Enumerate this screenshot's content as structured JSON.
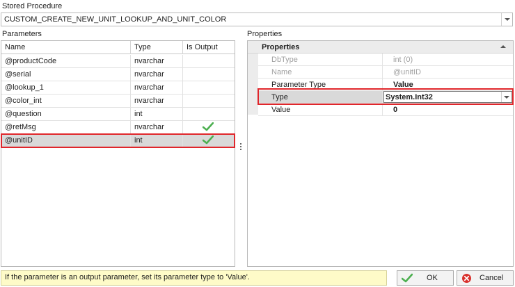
{
  "stored_procedure": {
    "label": "Stored Procedure",
    "value": "CUSTOM_CREATE_NEW_UNIT_LOOKUP_AND_UNIT_COLOR"
  },
  "parameters": {
    "label": "Parameters",
    "columns": [
      "Name",
      "Type",
      "Is Output"
    ],
    "rows": [
      {
        "name": "@productCode",
        "type": "nvarchar",
        "is_output": false
      },
      {
        "name": "@serial",
        "type": "nvarchar",
        "is_output": false
      },
      {
        "name": "@lookup_1",
        "type": "nvarchar",
        "is_output": false
      },
      {
        "name": "@color_int",
        "type": "nvarchar",
        "is_output": false
      },
      {
        "name": "@question",
        "type": "int",
        "is_output": false
      },
      {
        "name": "@retMsg",
        "type": "nvarchar",
        "is_output": true
      },
      {
        "name": "@unitID",
        "type": "int",
        "is_output": true
      }
    ],
    "selected_index": 6
  },
  "properties": {
    "label": "Properties",
    "category": "Properties",
    "items": [
      {
        "name": "DbType",
        "value": "int (0)"
      },
      {
        "name": "Name",
        "value": "@unitID"
      },
      {
        "name": "Parameter Type",
        "value": "Value"
      },
      {
        "name": "Type",
        "value": "System.Int32"
      },
      {
        "name": "Value",
        "value": "0"
      }
    ]
  },
  "status_message": "If the parameter is an output parameter, set its parameter type to 'Value'.",
  "buttons": {
    "ok": "OK",
    "cancel": "Cancel"
  },
  "colors": {
    "highlight_outline": "#e0262b",
    "status_background": "#fefbc8",
    "check_green": "#4caf50",
    "cancel_red": "#d9322e"
  }
}
